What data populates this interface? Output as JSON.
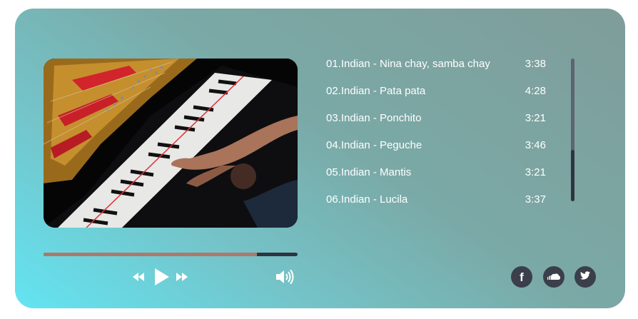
{
  "player": {
    "cover_icon": "piano-photo",
    "progress": 0.84,
    "controls": {
      "rewind_icon": "rewind-icon",
      "play_icon": "play-icon",
      "forward_icon": "fast-forward-icon",
      "volume_icon": "volume-icon"
    }
  },
  "playlist": [
    {
      "title": "01.Indian - Nina chay, samba chay",
      "time": "3:38"
    },
    {
      "title": "02.Indian - Pata pata",
      "time": "4:28"
    },
    {
      "title": "03.Indian - Ponchito",
      "time": "3:21"
    },
    {
      "title": "04.Indian - Peguche",
      "time": "3:46"
    },
    {
      "title": "05.Indian - Mantis",
      "time": "3:21"
    },
    {
      "title": "06.Indian - Lucila",
      "time": "3:37"
    }
  ],
  "social": {
    "facebook_icon": "facebook-icon",
    "facebook_glyph": "f",
    "soundcloud_icon": "soundcloud-icon",
    "twitter_icon": "twitter-icon"
  },
  "colors": {
    "progress_fill": "#b0786a",
    "progress_track": "#2f3440",
    "social_bg": "#3b3f4b"
  }
}
